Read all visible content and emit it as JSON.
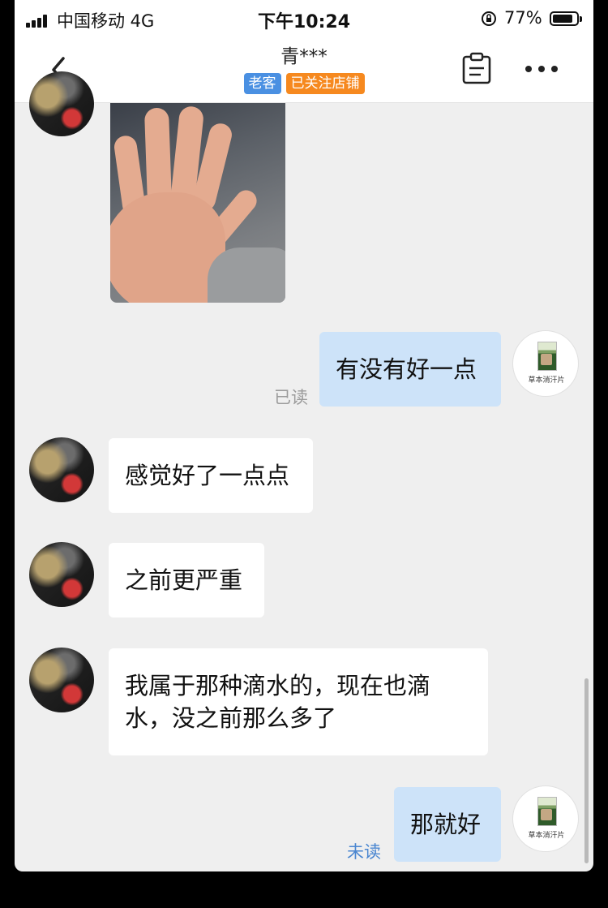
{
  "status_bar": {
    "carrier": "中国移动  4G",
    "time": "下午10:24",
    "battery": "77%",
    "battery_level": 0.77
  },
  "header": {
    "title": "青***",
    "badges": [
      "老客",
      "已关注店铺"
    ]
  },
  "shop": {
    "avatar_label": "草本消汗片"
  },
  "messages": [
    {
      "sender": "customer",
      "type": "image"
    },
    {
      "sender": "shop",
      "text": "有没有好一点",
      "status": "已读"
    },
    {
      "sender": "customer",
      "text": "感觉好了一点点"
    },
    {
      "sender": "customer",
      "text": "之前更严重"
    },
    {
      "sender": "customer",
      "text": "我属于那种滴水的，现在也滴水，没之前那么多了"
    },
    {
      "sender": "shop",
      "text": "那就好",
      "status": "未读"
    }
  ]
}
